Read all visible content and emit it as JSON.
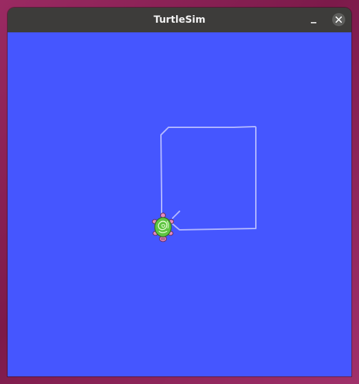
{
  "window": {
    "title": "TurtleSim"
  },
  "controls": {
    "minimize_icon": "minimize-icon",
    "close_icon": "close-icon"
  },
  "canvas": {
    "background_color": "#4556ff",
    "pen_color": "#b3b8ff"
  },
  "turtle": {
    "icon": "turtle-icon",
    "shell_color": "#5fc442",
    "body_color": "#e38ac2"
  }
}
